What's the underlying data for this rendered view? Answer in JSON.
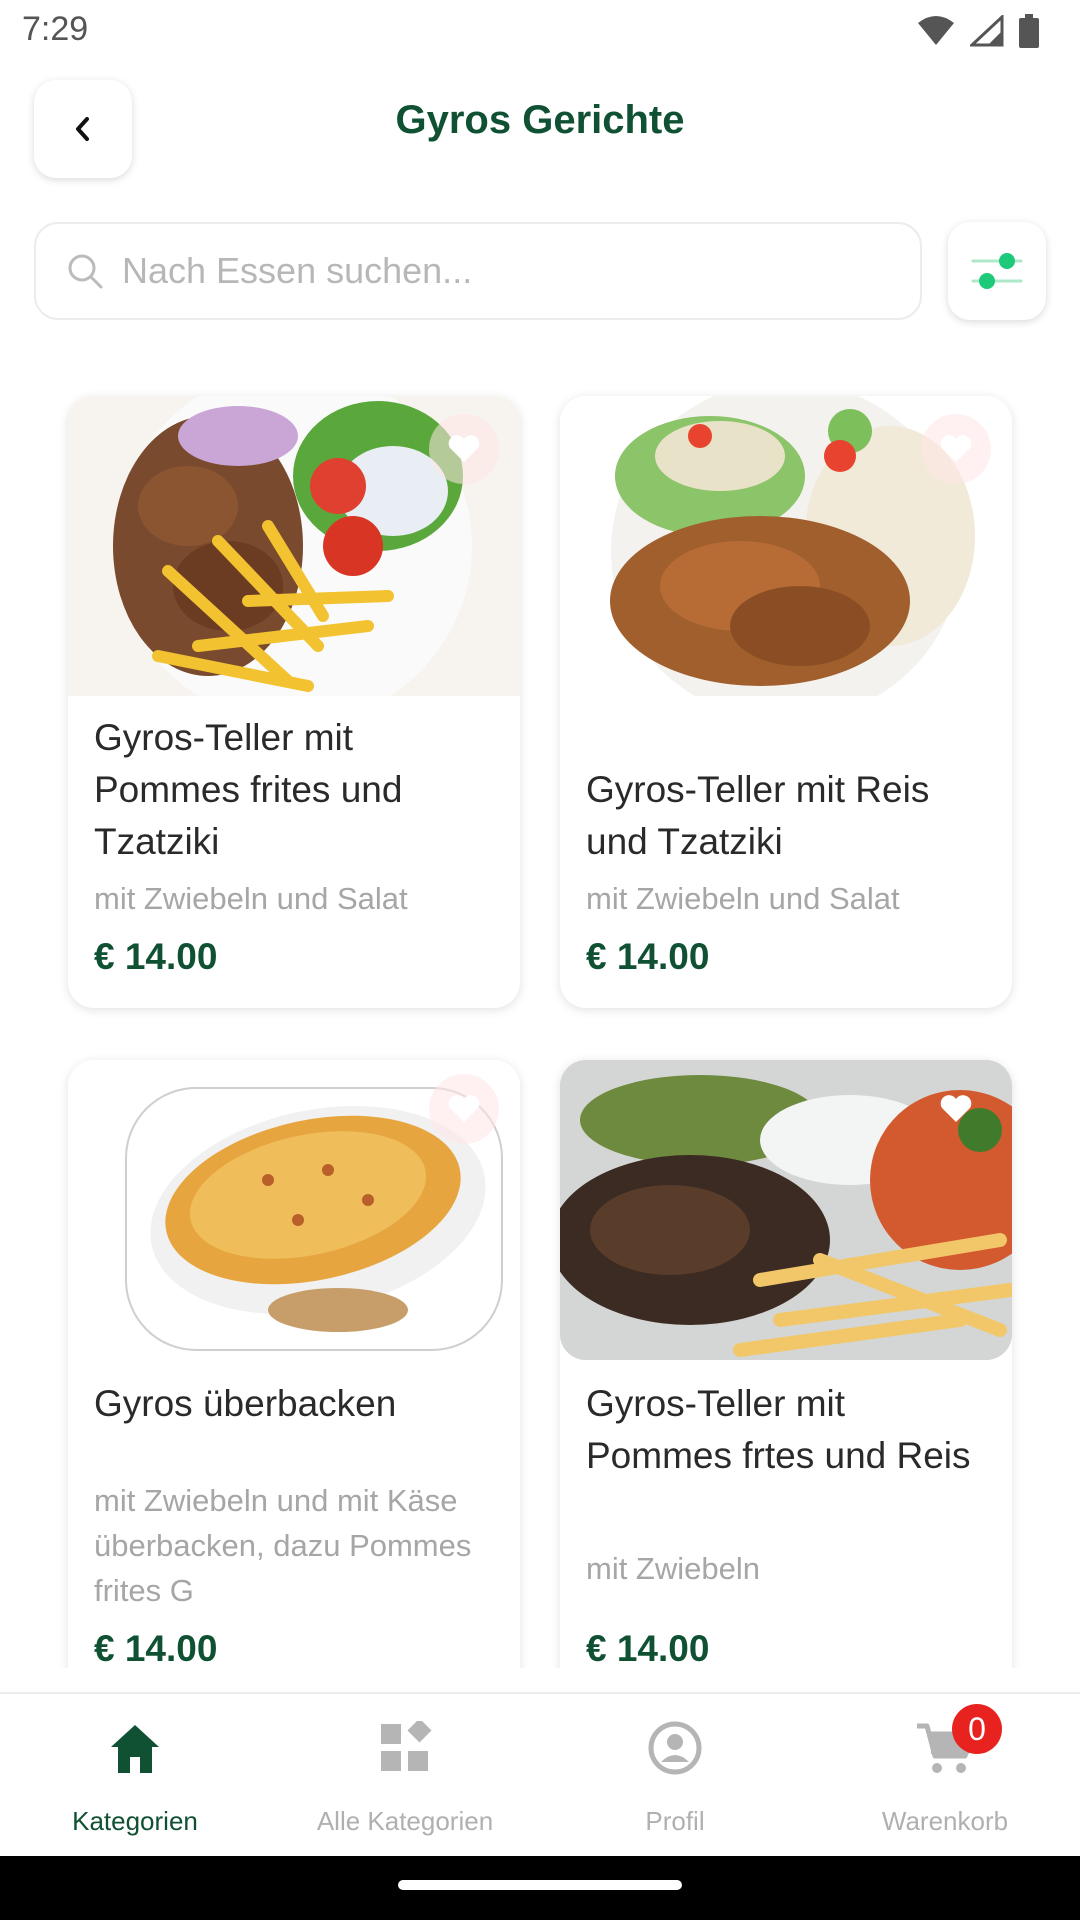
{
  "status_bar": {
    "time": "7:29"
  },
  "header": {
    "title": "Gyros Gerichte"
  },
  "search": {
    "placeholder": "Nach Essen suchen..."
  },
  "products": [
    {
      "title": "Gyros-Teller mit Pommes frites und Tzatziki",
      "description": "mit Zwiebeln und Salat",
      "price": "€ 14.00",
      "favorite_icon": "heart-icon"
    },
    {
      "title": "Gyros-Teller mit Reis und Tzatziki",
      "description": "mit Zwiebeln und Salat",
      "price": "€ 14.00",
      "favorite_icon": "heart-icon"
    },
    {
      "title": "Gyros überbacken",
      "description": "mit Zwiebeln und mit Käse überbacken, dazu Pommes frites G",
      "price": "€ 14.00",
      "favorite_icon": "heart-icon"
    },
    {
      "title": "Gyros-Teller mit Pommes frtes und Reis",
      "description": "mit Zwiebeln",
      "price": "€ 14.00",
      "favorite_icon": "heart-icon"
    }
  ],
  "bottom_nav": {
    "items": [
      {
        "label": "Kategorien",
        "icon": "home-icon",
        "active": true
      },
      {
        "label": "Alle Kategorien",
        "icon": "categories-icon",
        "active": false
      },
      {
        "label": "Profil",
        "icon": "profile-icon",
        "active": false
      },
      {
        "label": "Warenkorb",
        "icon": "cart-icon",
        "active": false
      }
    ],
    "cart_count": "0"
  },
  "colors": {
    "brand": "#0f5132",
    "accent": "#1ec97a",
    "badge": "#e8231f"
  }
}
